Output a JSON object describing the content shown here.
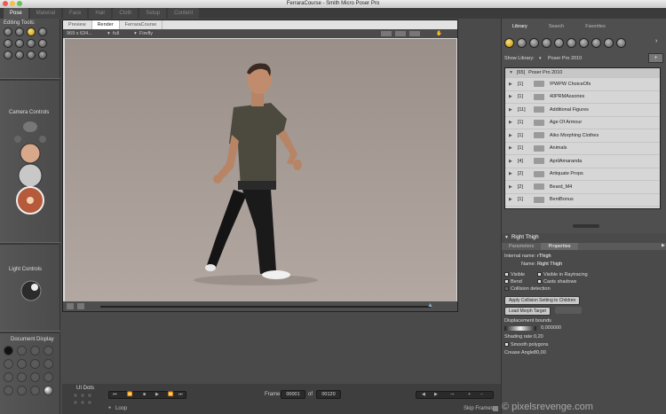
{
  "window": {
    "title": "FerraraCourse - Smith Micro Poser Pro"
  },
  "room_tabs": [
    "Pose",
    "Material",
    "Face",
    "Hair",
    "Cloth",
    "Setup",
    "Content"
  ],
  "left_panel": {
    "editing_tools_label": "Editing Tools:",
    "camera_controls_label": "Camera Controls",
    "light_controls_label": "Light Controls",
    "document_display_label": "Document Display"
  },
  "viewport": {
    "tabs": [
      "Preview",
      "Render",
      "FerraraCourse"
    ],
    "size_label": "969 x 634...",
    "quality_label": "full",
    "render_setting_label": "Firefly"
  },
  "bottom_bar": {
    "ui_dots_label": "UI Dots",
    "frame_label": "Frame",
    "frame_value": "00001",
    "of_label": "of",
    "total_frames": "00120",
    "loop_label": "Loop",
    "skip_frames_label": "Skip Frames"
  },
  "library": {
    "tabs": [
      "Library",
      "Search",
      "Favorites"
    ],
    "show_library_label": "Show Library:",
    "selected_library": "Poser Pro 2010",
    "header": {
      "count": "[65]",
      "name": "Poser Pro 2010"
    },
    "folders": [
      {
        "count": "[1]",
        "name": "!PWPW ChoiceOfs"
      },
      {
        "count": "[1]",
        "name": "40PRMAssories"
      },
      {
        "count": "[11]",
        "name": "Additional Figures"
      },
      {
        "count": "[1]",
        "name": "Age Of Armour"
      },
      {
        "count": "[1]",
        "name": "Aiko Morphing Clothes"
      },
      {
        "count": "[1]",
        "name": "Animals"
      },
      {
        "count": "[4]",
        "name": "AprilAmaranda"
      },
      {
        "count": "[2]",
        "name": "Artiquate Props"
      },
      {
        "count": "[2]",
        "name": "Beard_M4"
      },
      {
        "count": "[1]",
        "name": "BentBonus"
      }
    ]
  },
  "properties": {
    "title": "Right Thigh",
    "tabs": [
      "Parameters",
      "Properties"
    ],
    "internal_name_label": "Internal name:",
    "internal_name_value": "rThigh",
    "name_label": "Name:",
    "name_value": "Right Thigh",
    "visible_label": "Visible",
    "visible_raytracing_label": "Visible in Raytracing",
    "bend_label": "Bend",
    "casts_shadows_label": "Casts shadows",
    "collision_detection_label": "Collision detection",
    "apply_collision_button": "Apply Collision Setting to Children",
    "load_morph_button": "Load Morph Target",
    "displacement_bounds_label": "Displacement bounds",
    "displacement_value": "0,000000",
    "shading_rate_label": "Shading rate:",
    "shading_rate_value": "0,20",
    "smooth_polygons_label": "Smooth polygons",
    "crease_angle_label": "Crease Angle:",
    "crease_angle_value": "80,00"
  },
  "watermark": "© pixelsrevenge.com",
  "colors": {
    "accent_gold": "#e0b020",
    "panel": "#4a4a4a",
    "canvas": "#a99e98"
  }
}
